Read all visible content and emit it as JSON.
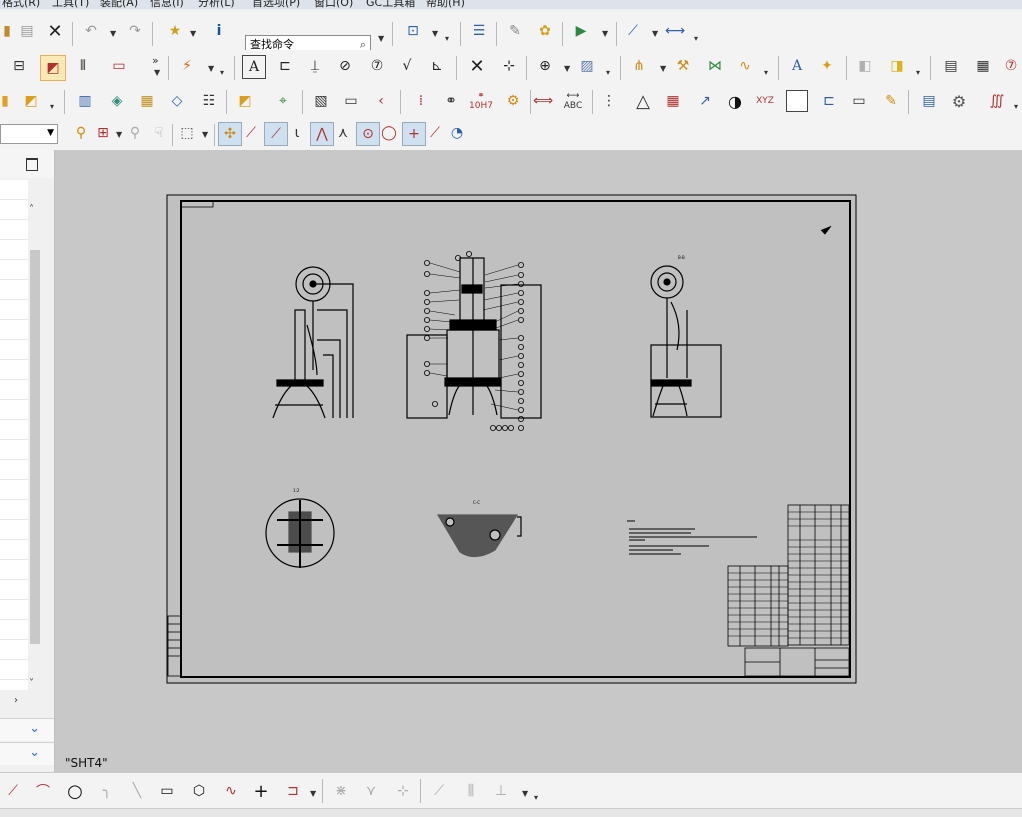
{
  "menu": {
    "items": [
      "格式(R)",
      "工具(T)",
      "装配(A)",
      "信息(I)",
      "分析(L)",
      "首选项(P)",
      "窗口(O)",
      "GC工具箱",
      "帮助(H)"
    ]
  },
  "toolbar": {
    "command_finder_placeholder": "查找命令",
    "label_10h7": "10H7",
    "label_abc": "ABC",
    "label_xyz": "XYZ"
  },
  "drawing": {
    "sheet_name": "\"SHT4\"",
    "detail_scale": "1:2",
    "view_label_right": "B-B",
    "view_label_bottom": "C-C"
  },
  "colors": {
    "viewport_bg": "#c8c8c8",
    "sheet_bg": "#c0c0c0",
    "ink": "#000000",
    "accent_chevron": "#2a6fd8"
  }
}
